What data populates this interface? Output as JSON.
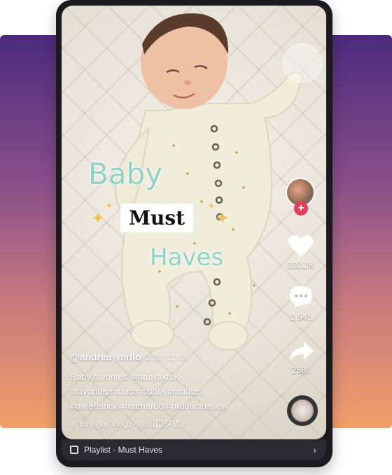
{
  "overlay": {
    "line1": "Baby",
    "line2": "Must",
    "line3": "Haves"
  },
  "author": {
    "username": "@andrea_mrllo",
    "date": "2020-11-18"
  },
  "caption": {
    "line1": "Baby favorites! #babytiktok",
    "line2": "#favoriteproducts #babyproducts",
    "line3": "#owlettsock #mamaroo #productreview"
  },
  "music": {
    "note_icon": "music-note-icon",
    "text": "tory (for Vlog) - @山口夕依"
  },
  "actions": {
    "likes": "332.2K",
    "comments": "2,541",
    "shares": "2588"
  },
  "playlist": {
    "label": "Playlist · Must Haves"
  },
  "colors": {
    "accent_text": "#8fd3c6",
    "follow_badge": "#ea3a5b",
    "gradient_top": "#4c2b7d",
    "gradient_bottom": "#f1a06a"
  }
}
